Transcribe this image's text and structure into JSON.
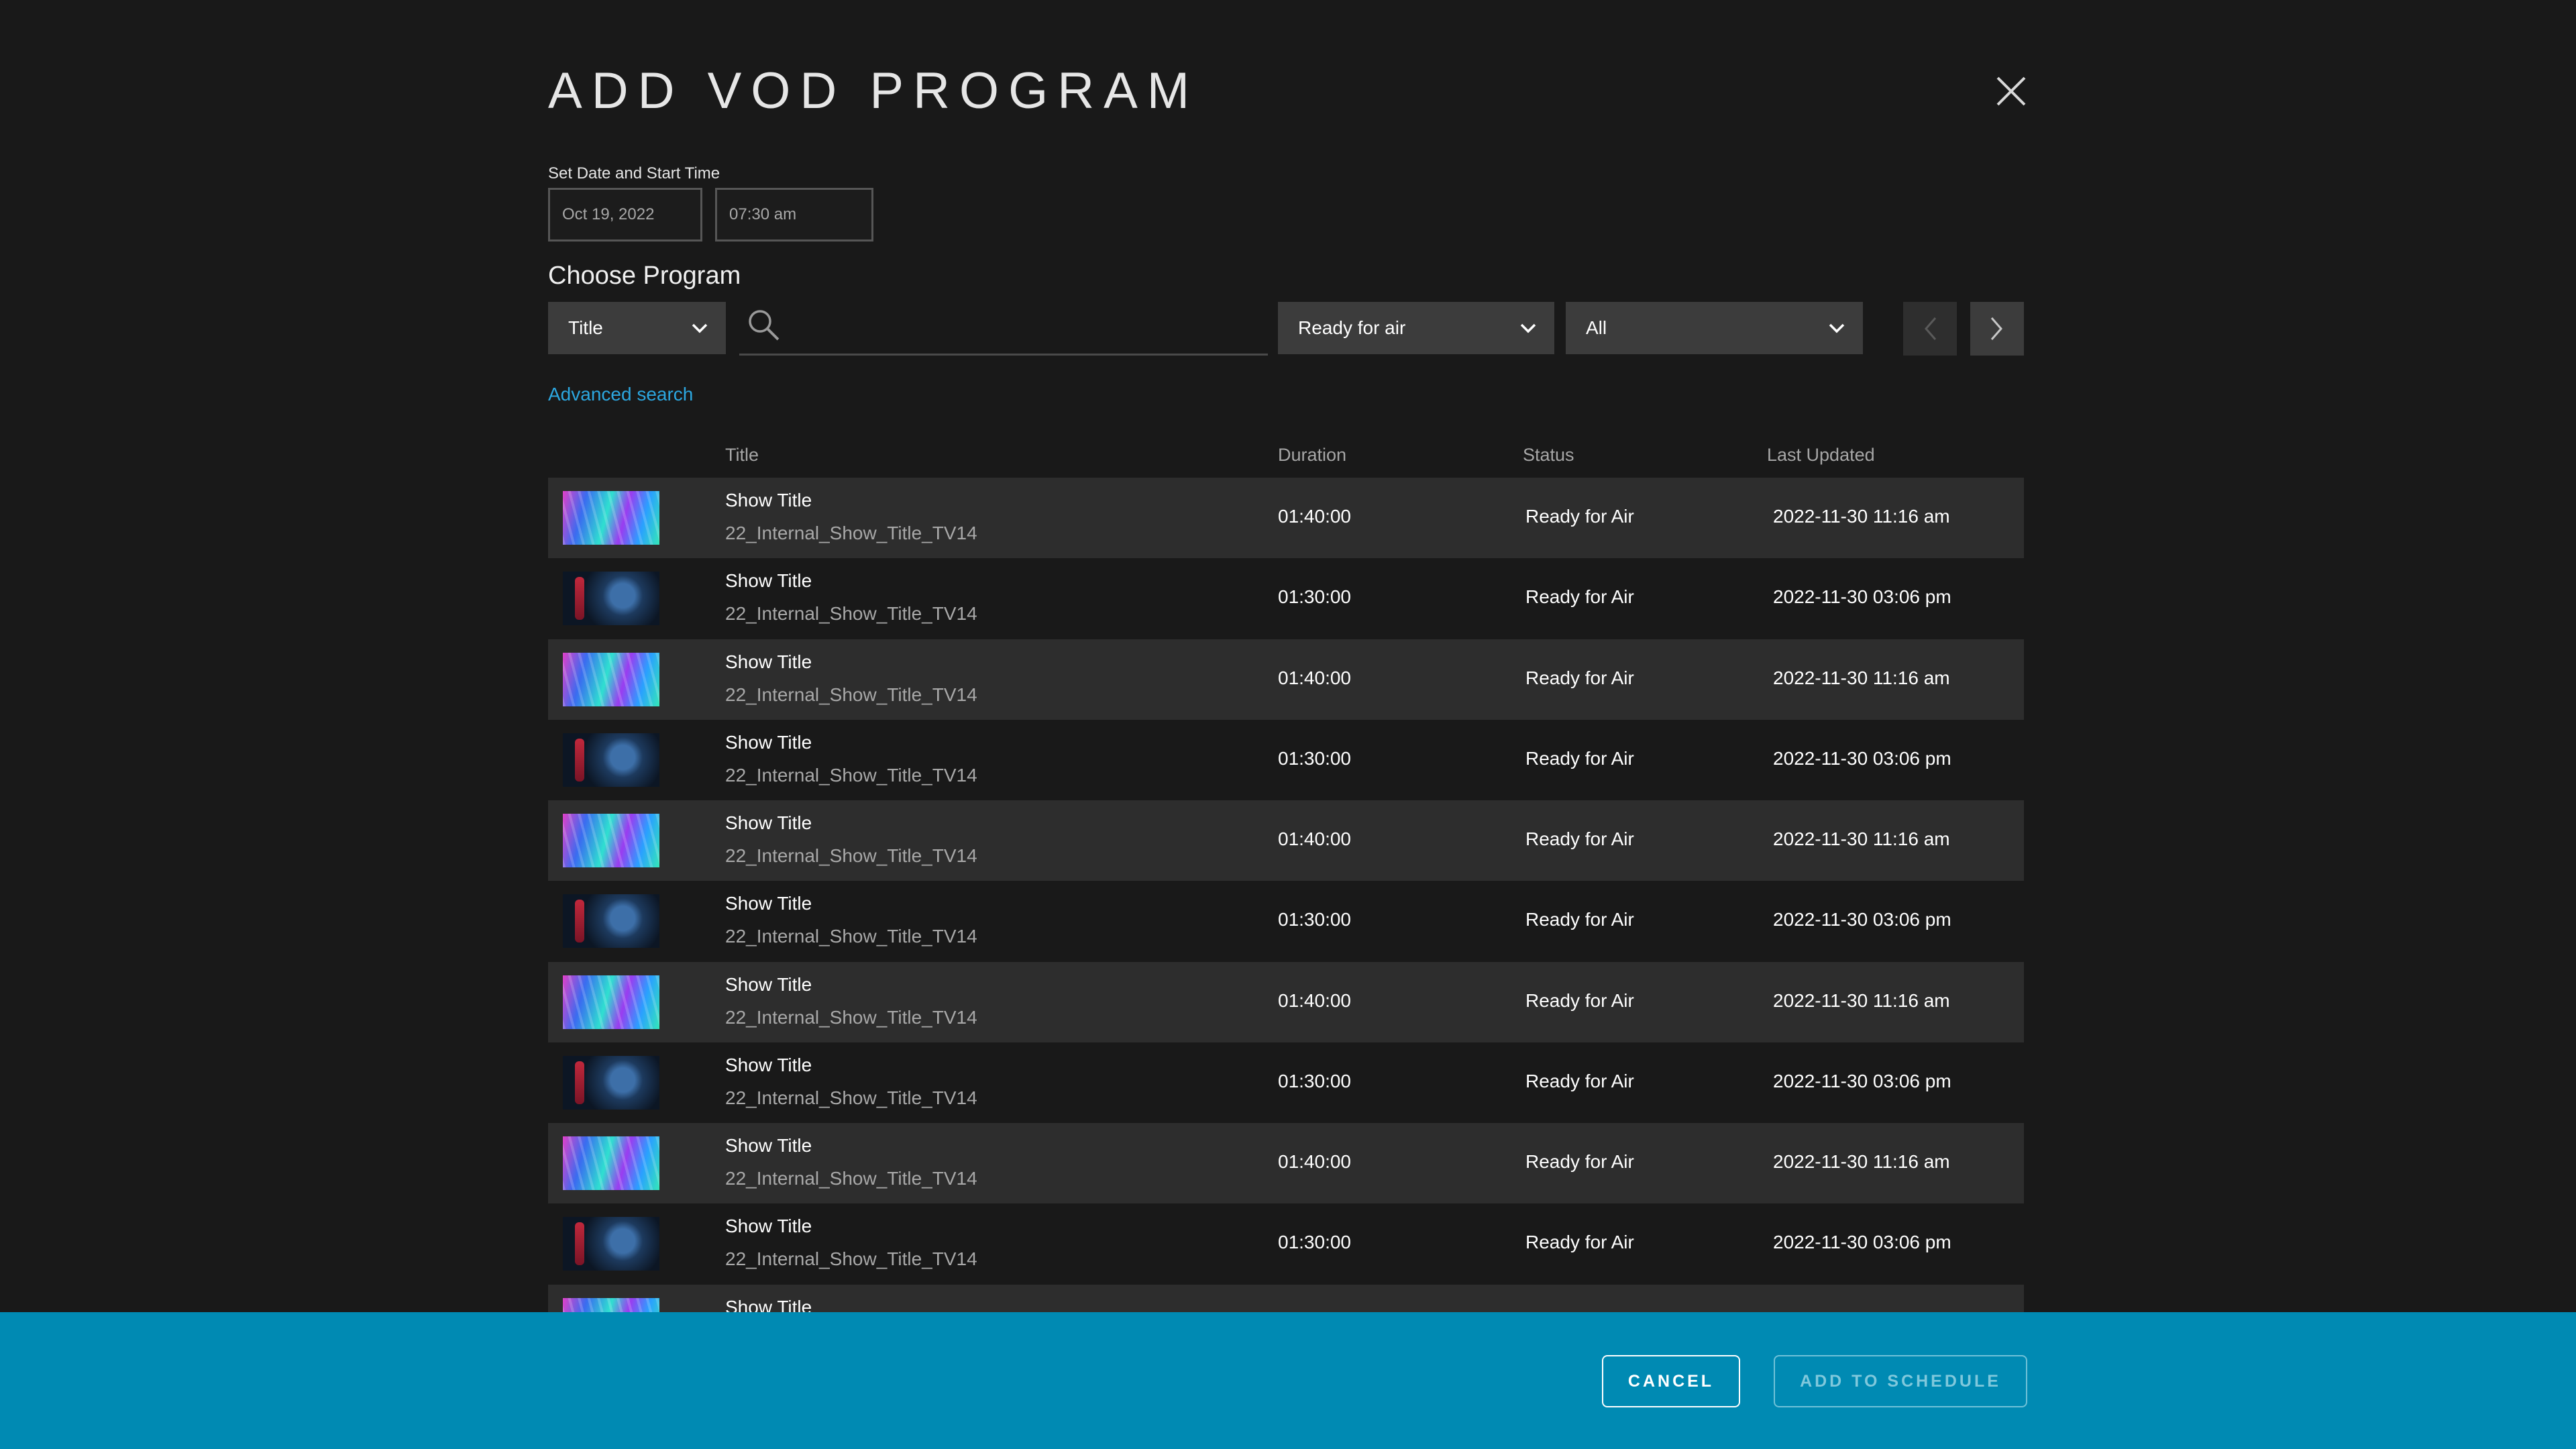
{
  "dialog": {
    "title": "ADD VOD PROGRAM",
    "close_icon": "close-icon"
  },
  "schedule": {
    "label": "Set Date and Start Time",
    "date": "Oct 19, 2022",
    "time": "07:30 am"
  },
  "choose": {
    "heading": "Choose Program",
    "search_type": "Title",
    "search_value": "",
    "status_filter": "Ready for air",
    "category_filter": "All",
    "advanced_search": "Advanced search",
    "icons": {
      "search": "search-icon",
      "dropdown": "chevron-down-icon",
      "prev": "chevron-left-icon",
      "next": "chevron-right-icon"
    }
  },
  "table": {
    "columns": [
      "Title",
      "Duration",
      "Status",
      "Last Updated"
    ],
    "rows": [
      {
        "thumbnail": "colorful-abstract",
        "title": "Show Title",
        "internal_name": "22_Internal_Show_Title_TV14",
        "duration": "01:40:00",
        "status": "Ready for Air",
        "last_updated": "2022-11-30 11:16 am"
      },
      {
        "thumbnail": "portrait",
        "title": "Show Title",
        "internal_name": "22_Internal_Show_Title_TV14",
        "duration": "01:30:00",
        "status": "Ready for Air",
        "last_updated": "2022-11-30 03:06 pm"
      },
      {
        "thumbnail": "colorful-abstract",
        "title": "Show Title",
        "internal_name": "22_Internal_Show_Title_TV14",
        "duration": "01:40:00",
        "status": "Ready for Air",
        "last_updated": "2022-11-30 11:16 am"
      },
      {
        "thumbnail": "portrait",
        "title": "Show Title",
        "internal_name": "22_Internal_Show_Title_TV14",
        "duration": "01:30:00",
        "status": "Ready for Air",
        "last_updated": "2022-11-30 03:06 pm"
      },
      {
        "thumbnail": "colorful-abstract",
        "title": "Show Title",
        "internal_name": "22_Internal_Show_Title_TV14",
        "duration": "01:40:00",
        "status": "Ready for Air",
        "last_updated": "2022-11-30 11:16 am"
      },
      {
        "thumbnail": "portrait",
        "title": "Show Title",
        "internal_name": "22_Internal_Show_Title_TV14",
        "duration": "01:30:00",
        "status": "Ready for Air",
        "last_updated": "2022-11-30 03:06 pm"
      },
      {
        "thumbnail": "colorful-abstract",
        "title": "Show Title",
        "internal_name": "22_Internal_Show_Title_TV14",
        "duration": "01:40:00",
        "status": "Ready for Air",
        "last_updated": "2022-11-30 11:16 am"
      },
      {
        "thumbnail": "portrait",
        "title": "Show Title",
        "internal_name": "22_Internal_Show_Title_TV14",
        "duration": "01:30:00",
        "status": "Ready for Air",
        "last_updated": "2022-11-30 03:06 pm"
      },
      {
        "thumbnail": "colorful-abstract",
        "title": "Show Title",
        "internal_name": "22_Internal_Show_Title_TV14",
        "duration": "01:40:00",
        "status": "Ready for Air",
        "last_updated": "2022-11-30 11:16 am"
      },
      {
        "thumbnail": "portrait",
        "title": "Show Title",
        "internal_name": "22_Internal_Show_Title_TV14",
        "duration": "01:30:00",
        "status": "Ready for Air",
        "last_updated": "2022-11-30 03:06 pm"
      },
      {
        "thumbnail": "colorful-abstract",
        "title": "Show Title",
        "internal_name": "",
        "duration": "",
        "status": "",
        "last_updated": ""
      }
    ]
  },
  "footer": {
    "cancel": "CANCEL",
    "add": "ADD TO SCHEDULE"
  },
  "colors": {
    "background": "#191919",
    "row_alt": "#2d2d2d",
    "link": "#2ca6df",
    "footer": "#008ab3"
  }
}
